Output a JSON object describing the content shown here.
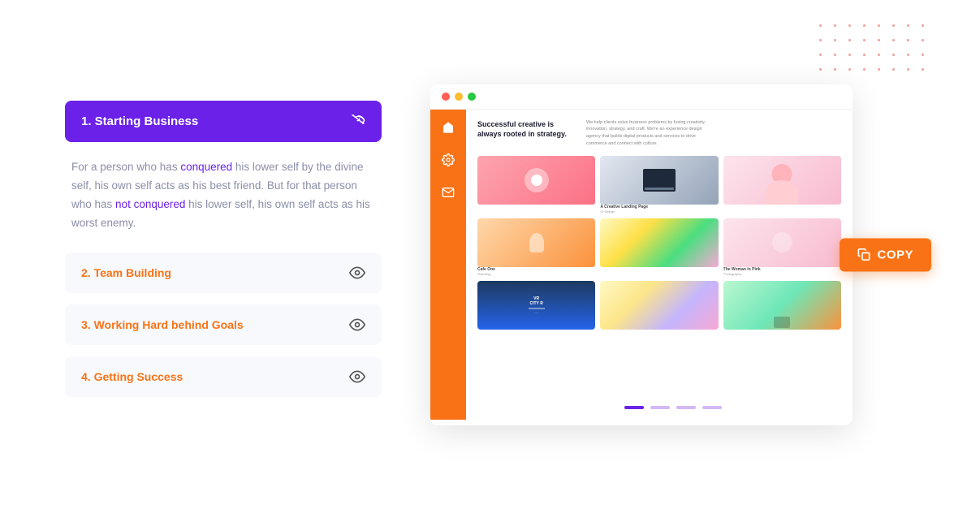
{
  "dots": {
    "color": "#f0a0a0"
  },
  "left_panel": {
    "active_item": {
      "label": "1. Starting Business",
      "icon": "eye-slash"
    },
    "active_content": "For a person who has conquered his lower self by the divine self, his own self acts as his best friend. But for that person who has not conquered his lower self, his own self acts as his worst enemy.",
    "items": [
      {
        "label": "2. Team Building",
        "num": "2",
        "text": "Team Building",
        "icon": "eye"
      },
      {
        "label": "3. Working Hard behind Goals",
        "num": "3",
        "text": "Working Hard behind Goals",
        "icon": "eye"
      },
      {
        "label": "4. Getting Success",
        "num": "4",
        "text": "Getting Success",
        "icon": "eye"
      }
    ]
  },
  "browser": {
    "site_headline": "Successful creative is always rooted in strategy.",
    "site_desc": "We help clients solve business problems by fusing creativity, innovation, strategy, and craft. We're an experience design agency that builds digital products and services to drive commerce and connect with culture.",
    "portfolio_items": [
      {
        "bg": "img-pink",
        "label": "",
        "sub": ""
      },
      {
        "bg": "img-laptop",
        "label": "A Creative Landing Page",
        "sub": "UI Design"
      },
      {
        "bg": "img-woman",
        "label": "",
        "sub": ""
      },
      {
        "bg": "img-cafe",
        "label": "Cafe One",
        "sub": "Branding"
      },
      {
        "bg": "img-geo",
        "label": "",
        "sub": ""
      },
      {
        "bg": "img-woman2",
        "label": "The Woman in Pink",
        "sub": "Photography"
      },
      {
        "bg": "img-vr",
        "label": "",
        "sub": ""
      },
      {
        "bg": "img-colorful",
        "label": "",
        "sub": ""
      },
      {
        "bg": "img-shoes",
        "label": "",
        "sub": ""
      }
    ],
    "nav_icons": [
      "home",
      "gear",
      "mail"
    ],
    "pagination": [
      "active",
      "inactive",
      "inactive",
      "inactive"
    ]
  },
  "copy_button": {
    "label": "COPY",
    "icon": "copy-icon"
  }
}
